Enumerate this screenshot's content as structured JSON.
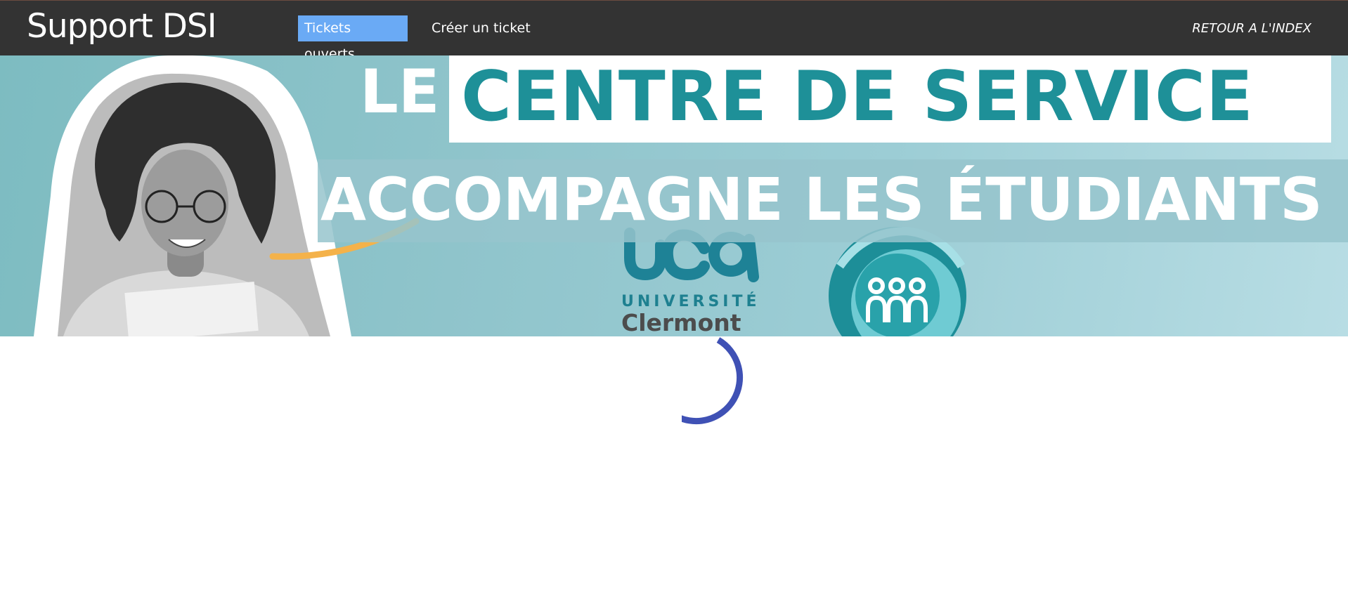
{
  "topbar": {
    "brand": "Support DSI",
    "tabs": [
      {
        "label": "Tickets ouverts",
        "active": true
      },
      {
        "label": "Créer un ticket",
        "active": false
      }
    ],
    "back_link": "RETOUR A L'INDEX"
  },
  "banner": {
    "headline_le": "LE",
    "headline_main": "CENTRE DE SERVICE",
    "headline_sub": "ACCOMPAGNE LES ÉTUDIANTS",
    "logo_university": "UNIVERSITÉ",
    "logo_city": "Clermont",
    "icons": [
      "uca-logo-icon",
      "students-circle-logo-icon",
      "student-photo"
    ]
  },
  "colors": {
    "topbar": "#333333",
    "active_tab": "#6aaaf5",
    "teal": "#1e9098",
    "banner_bg": "#8fc4cb",
    "spinner": "#3f51b5",
    "accent_arc": "#f4b24a"
  },
  "loading": {
    "icon": "loading-spinner-icon"
  }
}
